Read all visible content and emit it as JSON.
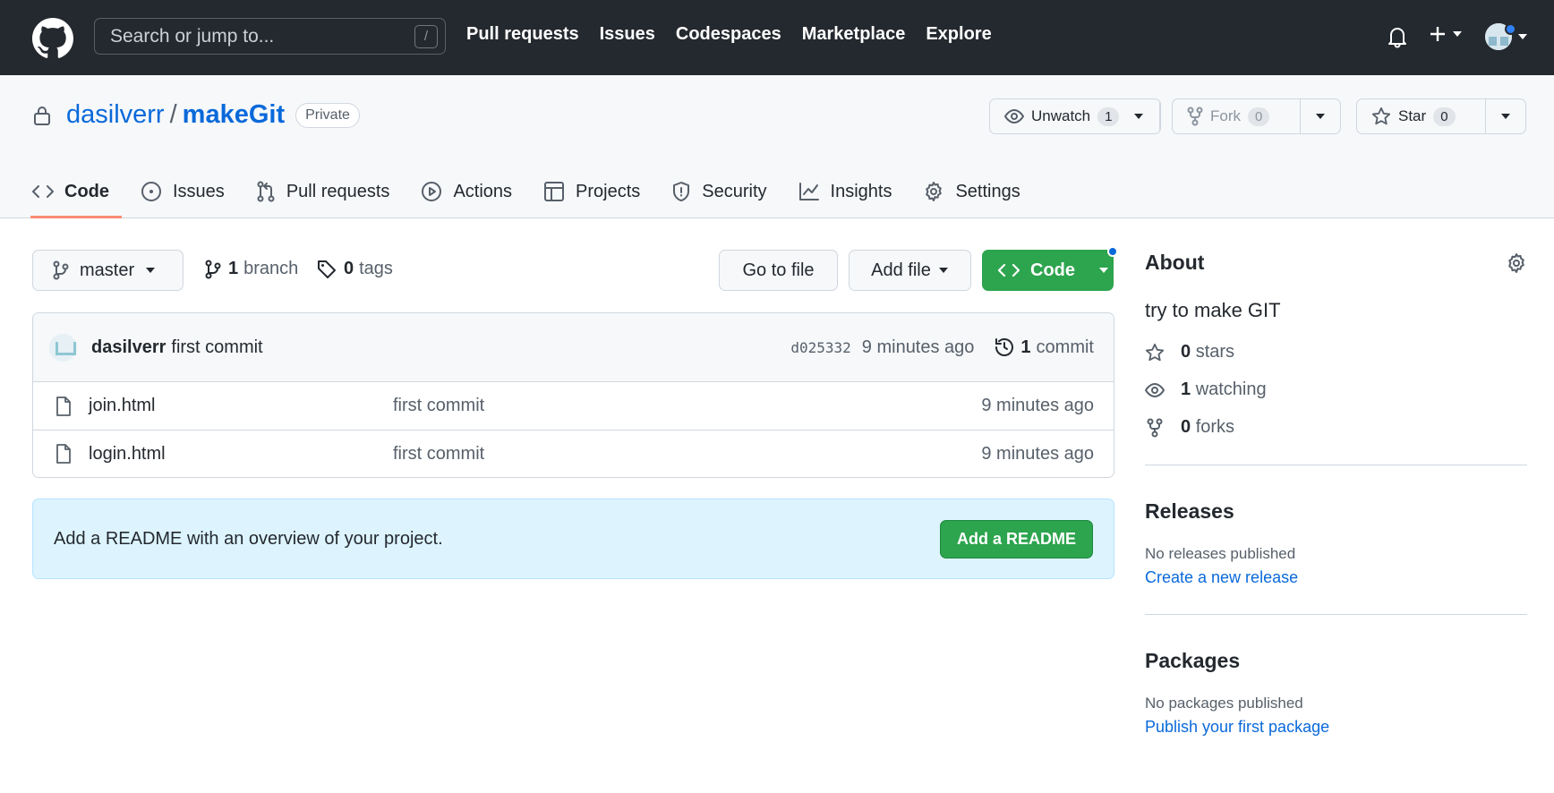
{
  "header": {
    "search_placeholder": "Search or jump to...",
    "search_shortcut": "/",
    "nav": [
      "Pull requests",
      "Issues",
      "Codespaces",
      "Marketplace",
      "Explore"
    ]
  },
  "repo": {
    "owner": "dasilverr",
    "separator": "/",
    "name": "makeGit",
    "visibility": "Private",
    "unwatch_label": "Unwatch",
    "unwatch_count": "1",
    "fork_label": "Fork",
    "fork_count": "0",
    "star_label": "Star",
    "star_count": "0"
  },
  "tabs": [
    "Code",
    "Issues",
    "Pull requests",
    "Actions",
    "Projects",
    "Security",
    "Insights",
    "Settings"
  ],
  "toolbar": {
    "branch": "master",
    "branch_count": "1",
    "branch_word": "branch",
    "tag_count": "0",
    "tag_word": "tags",
    "goto_file": "Go to file",
    "add_file": "Add file",
    "code": "Code"
  },
  "commit": {
    "user": "dasilverr",
    "message": "first commit",
    "sha": "d025332",
    "time": "9 minutes ago",
    "count": "1",
    "count_word": "commit"
  },
  "files": [
    {
      "name": "join.html",
      "message": "first commit",
      "time": "9 minutes ago"
    },
    {
      "name": "login.html",
      "message": "first commit",
      "time": "9 minutes ago"
    }
  ],
  "readme": {
    "text": "Add a README with an overview of your project.",
    "button": "Add a README"
  },
  "about": {
    "title": "About",
    "description": "try to make GIT",
    "stars_count": "0",
    "stars_word": "stars",
    "watching_count": "1",
    "watching_word": "watching",
    "forks_count": "0",
    "forks_word": "forks"
  },
  "releases": {
    "title": "Releases",
    "empty": "No releases published",
    "link": "Create a new release"
  },
  "packages": {
    "title": "Packages",
    "empty": "No packages published",
    "link": "Publish your first package"
  },
  "colors": {
    "header_bg": "#24292f",
    "accent_link": "#0969da",
    "primary_button": "#2da44e",
    "tab_underline": "#fd8c73"
  }
}
